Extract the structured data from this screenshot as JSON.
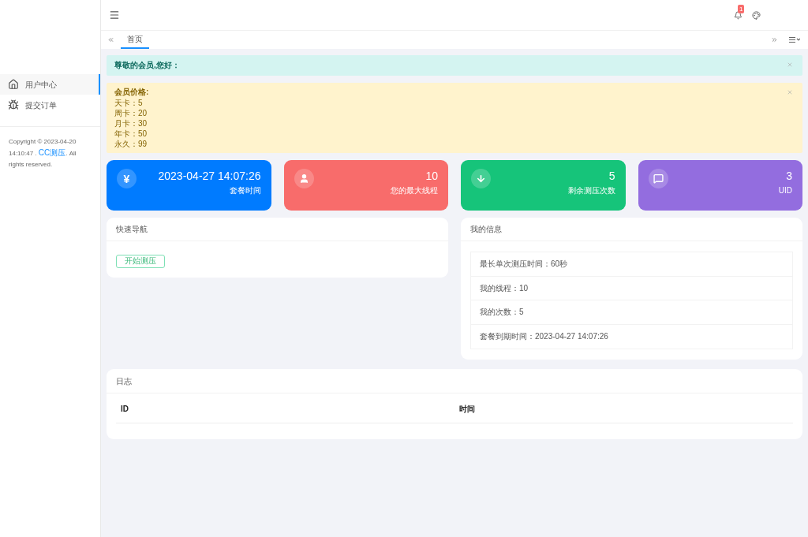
{
  "sidebar": {
    "items": [
      {
        "label": "用户中心",
        "selected": true
      },
      {
        "label": "提交订单",
        "selected": false
      }
    ],
    "copyright": {
      "text": "Copyright © 2023-04-20 14:10:47 .",
      "link": "CC测压",
      "suffix": ". All rights reserved."
    }
  },
  "header": {
    "notification_count": "1"
  },
  "tabs": [
    {
      "label": "首页",
      "selected": true
    }
  ],
  "alerts": [
    {
      "kind": "info",
      "title": "尊敬的会员,您好："
    },
    {
      "kind": "warning",
      "title": "会员价格:",
      "lines": [
        "天卡：5",
        "周卡：20",
        "月卡：30",
        "年卡：50",
        "永久：99"
      ]
    }
  ],
  "stats": [
    {
      "symbol": "¥",
      "value": "2023-04-27 14:07:26",
      "label": "套餐时间",
      "color": "#007bff"
    },
    {
      "value": "10",
      "label": "您的最大线程",
      "color": "#f86c6b"
    },
    {
      "value": "5",
      "label": "剩余测压次数",
      "color": "#16c47a"
    },
    {
      "value": "3",
      "label": "UID",
      "color": "#936ddf"
    }
  ],
  "quick_nav": {
    "title": "快速导航",
    "button": "开始测压"
  },
  "my_info": {
    "title": "我的信息",
    "rows": [
      "最长单次测压时间：60秒",
      "我的线程：10",
      "我的次数：5",
      "套餐到期时间：2023-04-27 14:07:26"
    ]
  },
  "log": {
    "title": "日志",
    "columns": [
      "ID",
      "时间"
    ]
  }
}
